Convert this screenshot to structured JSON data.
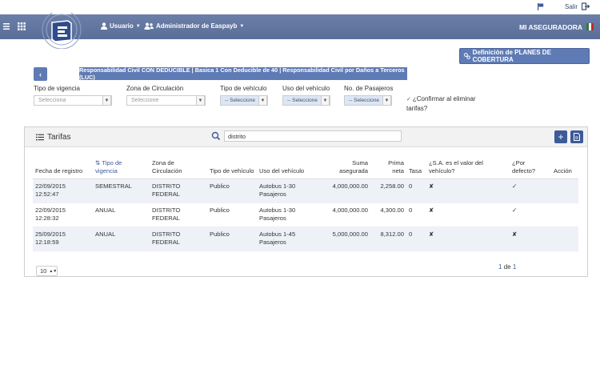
{
  "topbar": {
    "logout_label": "Salir"
  },
  "navbar": {
    "user_menu": "Usuario",
    "admin_menu": "Administrador de Easpayb",
    "brand": "MI ASEGURADORA"
  },
  "actions": {
    "planes_button": "Definición de PLANES DE COBERTURA",
    "back": "‹"
  },
  "plan_banner": "Responsabilidad Civil CON DEDUCIBLE | Basica 1 Con Deducible de 40 | Responsabilidad Civil por Daños a Terceros (LUC)",
  "filters": {
    "tipo_vigencia": {
      "label": "Tipo de vigencia",
      "placeholder": "Selecciona"
    },
    "zona": {
      "label": "Zona de Circulación",
      "placeholder": "Seleccione"
    },
    "tipo_vehiculo": {
      "label": "Tipo de vehículo",
      "placeholder": "-- Seleccione"
    },
    "uso_vehiculo": {
      "label": "Uso del vehículo",
      "placeholder": "-- Seleccione"
    },
    "pasajeros": {
      "label": "No. de Pasajeros",
      "placeholder": "-- Seleccione"
    },
    "confirm_line1": "¿Confirmar al eliminar",
    "confirm_line2": "tarifas?"
  },
  "panel": {
    "title": "Tarifas",
    "search_value": "distrito",
    "columns": {
      "fecha": "Fecha de registro",
      "tipo_vig_1": "Tipo de",
      "tipo_vig_2": "vigencia",
      "zona_1": "Zona de",
      "zona_2": "Circulación",
      "tipo_veh": "Tipo de vehículo",
      "uso": "Uso del vehículo",
      "suma_1": "Suma",
      "suma_2": "asegurada",
      "prima_1": "Prima",
      "prima_2": "neta",
      "tasa": "Tasa",
      "sa_1": "¿S.A. es el valor del",
      "sa_2": "vehículo?",
      "defecto": "¿Por defecto?",
      "accion": "Acción"
    },
    "rows": [
      {
        "fecha": "22/09/2015",
        "hora": "12:52:47",
        "vigencia": "SEMESTRAL",
        "zona": "DISTRITO FEDERAL",
        "tipo": "Publico",
        "uso1": "Autobus 1-30",
        "uso2": "Pasajeros",
        "suma": "4,000,000.00",
        "prima": "2,258.00",
        "tasa": "0",
        "sa": "✘",
        "defecto": "✓"
      },
      {
        "fecha": "22/09/2015",
        "hora": "12:28:32",
        "vigencia": "ANUAL",
        "zona": "DISTRITO FEDERAL",
        "tipo": "Publico",
        "uso1": "Autobus 1-30",
        "uso2": "Pasajeros",
        "suma": "4,000,000.00",
        "prima": "4,300.00",
        "tasa": "0",
        "sa": "✘",
        "defecto": "✓"
      },
      {
        "fecha": "25/09/2015",
        "hora": "12:18:59",
        "vigencia": "ANUAL",
        "zona": "DISTRITO FEDERAL",
        "tipo": "Publico",
        "uso1": "Autobus 1-45",
        "uso2": "Pasajeros",
        "suma": "5,000,000.00",
        "prima": "8,312.00",
        "tasa": "0",
        "sa": "✘",
        "defecto": "✘"
      }
    ],
    "page_size": "10",
    "page_current": "1",
    "page_sep": "de",
    "page_total": "1"
  },
  "colors": {
    "nav": "#6b7fa8",
    "accent": "#5f7bb5",
    "dark_accent": "#3d5a99"
  }
}
